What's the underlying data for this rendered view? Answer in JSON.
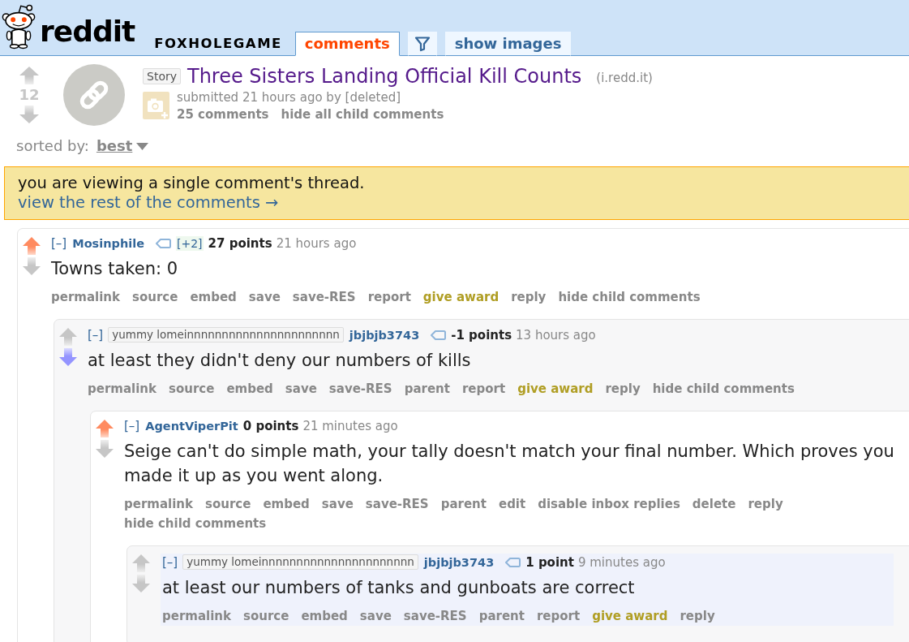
{
  "header": {
    "logo_text": "reddit",
    "subreddit": "FOXHOLEGAME",
    "tabs": [
      {
        "kind": "text",
        "label": "comments",
        "selected": true
      },
      {
        "kind": "filter",
        "selected": false
      },
      {
        "kind": "text",
        "label": "show images",
        "selected": false
      }
    ]
  },
  "post": {
    "upvoted": false,
    "downvoted": false,
    "score": "12",
    "flair": "Story",
    "title": "Three Sisters Landing Official Kill Counts",
    "domain": "(i.redd.it)",
    "submitted": "submitted 21 hours ago by [deleted]",
    "links": [
      "25 comments",
      "hide all child comments"
    ]
  },
  "sort": {
    "label": "sorted by:",
    "value": "best"
  },
  "notice": {
    "text": "you are viewing a single comment's thread.",
    "link": "view the rest of the comments →"
  },
  "comments": [
    {
      "upvoted": true,
      "downvoted": false,
      "highlighted": false,
      "collapse": "[–]",
      "author": "Mosinphile",
      "user_tag": true,
      "vote_weight": "[+2]",
      "score": "27 points",
      "time": "21 hours ago",
      "body": "Towns taken: 0",
      "actions": [
        {
          "label": "permalink",
          "kind": "link"
        },
        {
          "label": "source",
          "kind": "link"
        },
        {
          "label": "embed",
          "kind": "link"
        },
        {
          "label": "save",
          "kind": "link"
        },
        {
          "label": "save-RES",
          "kind": "link"
        },
        {
          "label": "report",
          "kind": "link"
        },
        {
          "label": "give award",
          "kind": "award"
        },
        {
          "label": "reply",
          "kind": "link"
        },
        {
          "label": "hide child comments",
          "kind": "link"
        }
      ],
      "children": [
        {
          "upvoted": false,
          "downvoted": true,
          "highlighted": false,
          "collapse": "[–]",
          "flair": "yummy lomeinnnnnnnnnnnnnnnnnnnnnn",
          "author": "jbjbjb3743",
          "user_tag": true,
          "score": "-1 points",
          "time": "13 hours ago",
          "body": "at least they didn't deny our numbers of kills",
          "actions": [
            {
              "label": "permalink",
              "kind": "link"
            },
            {
              "label": "source",
              "kind": "link"
            },
            {
              "label": "embed",
              "kind": "link"
            },
            {
              "label": "save",
              "kind": "link"
            },
            {
              "label": "save-RES",
              "kind": "link"
            },
            {
              "label": "parent",
              "kind": "link"
            },
            {
              "label": "report",
              "kind": "link"
            },
            {
              "label": "give award",
              "kind": "award"
            },
            {
              "label": "reply",
              "kind": "link"
            },
            {
              "label": "hide child comments",
              "kind": "link"
            }
          ],
          "children": [
            {
              "upvoted": true,
              "downvoted": false,
              "highlighted": false,
              "collapse": "[–]",
              "author": "AgentViperPit",
              "user_tag": false,
              "score": "0 points",
              "time": "21 minutes ago",
              "body": "Seige can't do simple math, your tally doesn't match your final number. Which proves you made it up as you went along.",
              "actions": [
                {
                  "label": "permalink",
                  "kind": "link"
                },
                {
                  "label": "source",
                  "kind": "link"
                },
                {
                  "label": "embed",
                  "kind": "link"
                },
                {
                  "label": "save",
                  "kind": "link"
                },
                {
                  "label": "save-RES",
                  "kind": "link"
                },
                {
                  "label": "parent",
                  "kind": "link"
                },
                {
                  "label": "edit",
                  "kind": "link"
                },
                {
                  "label": "disable inbox replies",
                  "kind": "link"
                },
                {
                  "label": "delete",
                  "kind": "link"
                },
                {
                  "label": "reply",
                  "kind": "link"
                },
                {
                  "label": "hide child comments",
                  "kind": "link"
                }
              ],
              "children": [
                {
                  "upvoted": false,
                  "downvoted": false,
                  "highlighted": true,
                  "collapse": "[–]",
                  "flair": "yummy lomeinnnnnnnnnnnnnnnnnnnnnn",
                  "author": "jbjbjb3743",
                  "user_tag": true,
                  "score": "1 point",
                  "time": "9 minutes ago",
                  "body": "at least our numbers of tanks and gunboats are correct",
                  "actions": [
                    {
                      "label": "permalink",
                      "kind": "link"
                    },
                    {
                      "label": "source",
                      "kind": "link"
                    },
                    {
                      "label": "embed",
                      "kind": "link"
                    },
                    {
                      "label": "save",
                      "kind": "link"
                    },
                    {
                      "label": "save-RES",
                      "kind": "link"
                    },
                    {
                      "label": "parent",
                      "kind": "link"
                    },
                    {
                      "label": "report",
                      "kind": "link"
                    },
                    {
                      "label": "give award",
                      "kind": "award"
                    },
                    {
                      "label": "reply",
                      "kind": "link"
                    }
                  ]
                }
              ]
            }
          ]
        }
      ]
    }
  ]
}
